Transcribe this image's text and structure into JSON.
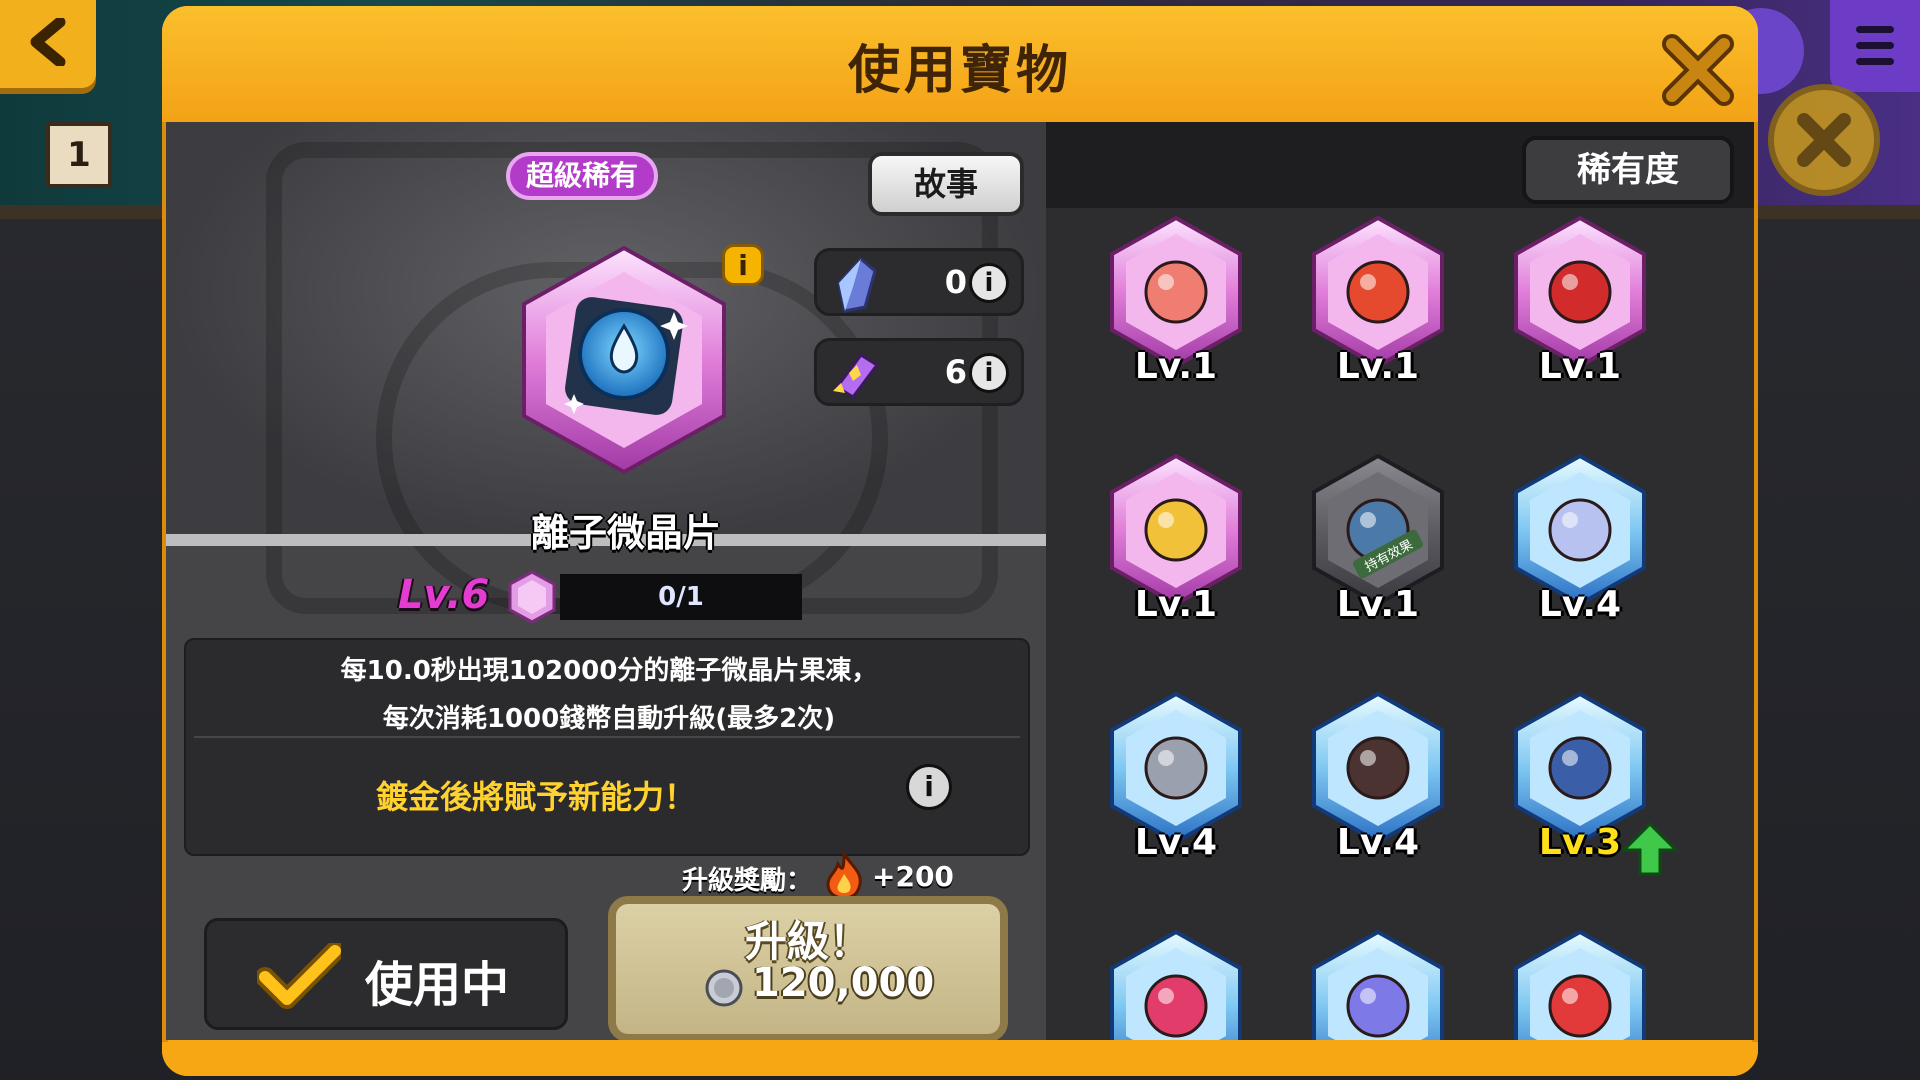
{
  "modal": {
    "title": "使用寶物"
  },
  "treasure": {
    "rarity": "超級稀有",
    "story_label": "故事",
    "name": "離子微晶片",
    "level": "Lv.6",
    "progress": "0/1",
    "description_line1": "每10.0秒出現102000分的離子微晶片果凍，",
    "description_line2": "每次消耗1000錢幣自動升級(最多2次)",
    "gild_text": "鍍金後將賦予新能力！",
    "info_glyph": "i"
  },
  "resources": [
    {
      "icon": "crystal-icon",
      "value": "0",
      "info": "i"
    },
    {
      "icon": "ticket-icon",
      "value": "6",
      "info": "i"
    }
  ],
  "reward": {
    "label": "升級獎勵：",
    "icon": "flame-icon",
    "value": "+200"
  },
  "buttons": {
    "in_use": "使用中",
    "upgrade": "升級！",
    "upgrade_cost": "120,000",
    "rarity_sort": "稀有度"
  },
  "grid": [
    {
      "name": "grapefruit-drink",
      "level": "Lv.1",
      "frame": "pink"
    },
    {
      "name": "rainbow-blanket",
      "level": "Lv.1",
      "frame": "pink"
    },
    {
      "name": "red-carpet",
      "level": "Lv.1",
      "frame": "pink"
    },
    {
      "name": "bear-snowglobe",
      "level": "Lv.1",
      "frame": "pink"
    },
    {
      "name": "ring-owned-effect",
      "level": "Lv.1",
      "frame": "dark",
      "badge": "持有效果"
    },
    {
      "name": "flower-emblem",
      "level": "Lv.4",
      "frame": "blue"
    },
    {
      "name": "sword",
      "level": "Lv.4",
      "frame": "blue"
    },
    {
      "name": "spiked-mace",
      "level": "Lv.4",
      "frame": "blue"
    },
    {
      "name": "book",
      "level": "Lv.3",
      "frame": "blue",
      "upgradable": true
    },
    {
      "name": "pink-egg",
      "level": "",
      "frame": "blue"
    },
    {
      "name": "crystal-vase",
      "level": "",
      "frame": "blue"
    },
    {
      "name": "winged-shoe",
      "level": "",
      "frame": "blue"
    }
  ],
  "colors": {
    "accent_orange": "#f6a713",
    "rarity_purple": "#b23cc9",
    "level_gold": "#ffdf1a"
  }
}
